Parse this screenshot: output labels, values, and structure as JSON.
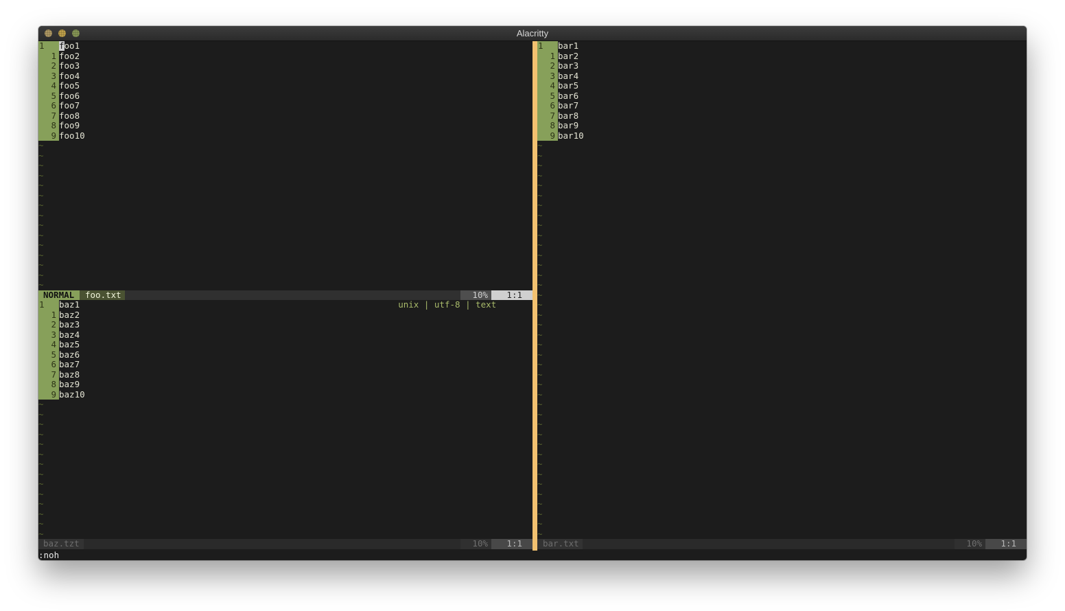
{
  "window": {
    "title": "Alacritty"
  },
  "panes": {
    "foo": {
      "current_line": "1",
      "relative_numbers": [
        "1",
        "2",
        "3",
        "4",
        "5",
        "6",
        "7",
        "8",
        "9"
      ],
      "lines": [
        "foo1",
        "foo2",
        "foo3",
        "foo4",
        "foo5",
        "foo6",
        "foo7",
        "foo8",
        "foo9",
        "foo10"
      ],
      "empty_marker": "~"
    },
    "baz": {
      "current_line": "1",
      "relative_numbers": [
        "1",
        "2",
        "3",
        "4",
        "5",
        "6",
        "7",
        "8",
        "9"
      ],
      "lines": [
        "baz1",
        "baz2",
        "baz3",
        "baz4",
        "baz5",
        "baz6",
        "baz7",
        "baz8",
        "baz9",
        "baz10"
      ],
      "empty_marker": "~"
    },
    "bar": {
      "current_line": "1",
      "relative_numbers": [
        "1",
        "2",
        "3",
        "4",
        "5",
        "6",
        "7",
        "8",
        "9"
      ],
      "lines": [
        "bar1",
        "bar2",
        "bar3",
        "bar4",
        "bar5",
        "bar6",
        "bar7",
        "bar8",
        "bar9",
        "bar10"
      ],
      "empty_marker": "~"
    }
  },
  "statuslines": {
    "foo": {
      "mode": "NORMAL",
      "filename": "foo.txt",
      "format": "unix",
      "encoding": "utf-8",
      "filetype": "text",
      "percent": "10%",
      "position": "1:1"
    },
    "baz": {
      "filename": "baz.tzt",
      "percent": "10%",
      "position": "1:1"
    },
    "bar": {
      "filename": "bar.txt",
      "percent": "10%",
      "position": "1:1"
    }
  },
  "command_line": ":noh",
  "colors": {
    "background": "#1c1c1c",
    "line_number_bg": "#87a05a",
    "tilde": "#56622e",
    "split_separator": "#f2c170",
    "status_active_text": "#a8ba6a"
  }
}
